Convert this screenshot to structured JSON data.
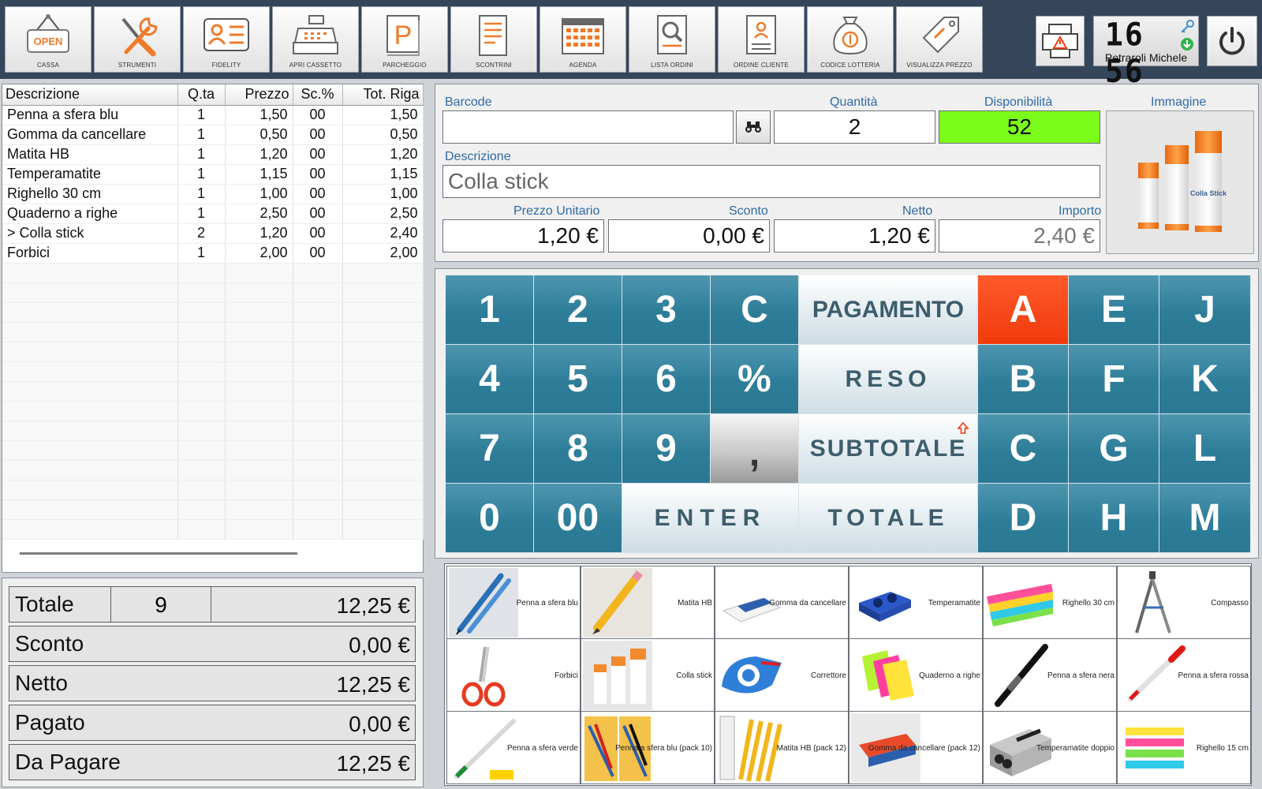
{
  "toolbar": {
    "buttons": [
      {
        "label": "CASSA",
        "icon": "open-sign-icon"
      },
      {
        "label": "STRUMENTI",
        "icon": "tools-icon"
      },
      {
        "label": "FIDELITY",
        "icon": "id-card-icon"
      },
      {
        "label": "APRI CASSETTO",
        "icon": "cash-register-icon"
      },
      {
        "label": "PARCHEGGIO",
        "icon": "parking-icon"
      },
      {
        "label": "SCONTRINI",
        "icon": "receipt-icon"
      },
      {
        "label": "AGENDA",
        "icon": "calendar-icon"
      },
      {
        "label": "LISTA ORDINI",
        "icon": "order-search-icon"
      },
      {
        "label": "ORDINE CLIENTE",
        "icon": "customer-order-icon"
      },
      {
        "label": "CODICE LOTTERIA",
        "icon": "money-bag-icon"
      },
      {
        "label": "VISUALIZZA PREZZO",
        "icon": "price-tag-icon"
      }
    ],
    "open_sign_text": "OPEN",
    "parking_letter": "P",
    "clock": {
      "time": "16 56",
      "user": "Petraroli Michele"
    },
    "accent_color": "#f07a2a"
  },
  "receipt": {
    "columns": [
      "Descrizione",
      "Q.ta",
      "Prezzo",
      "Sc.%",
      "Tot. Riga"
    ],
    "rows": [
      [
        "Penna a sfera blu",
        "1",
        "1,50",
        "00",
        "1,50"
      ],
      [
        "Gomma da cancellare",
        "1",
        "0,50",
        "00",
        "0,50"
      ],
      [
        "Matita HB",
        "1",
        "1,20",
        "00",
        "1,20"
      ],
      [
        "Temperamatite",
        "1",
        "1,15",
        "00",
        "1,15"
      ],
      [
        "Righello 30 cm",
        "1",
        "1,00",
        "00",
        "1,00"
      ],
      [
        "Quaderno a righe",
        "1",
        "2,50",
        "00",
        "2,50"
      ],
      [
        "> Colla stick",
        "2",
        "1,20",
        "00",
        "2,40"
      ],
      [
        "Forbici",
        "1",
        "2,00",
        "00",
        "2,00"
      ]
    ]
  },
  "totals": {
    "totale": {
      "label": "Totale",
      "qty": "9",
      "value": "12,25 €"
    },
    "sconto": {
      "label": "Sconto",
      "value": "0,00 €"
    },
    "netto": {
      "label": "Netto",
      "value": "12,25 €"
    },
    "pagato": {
      "label": "Pagato",
      "value": "0,00 €"
    },
    "da_pagare": {
      "label": "Da Pagare",
      "value": "12,25 €"
    }
  },
  "item": {
    "barcode_label": "Barcode",
    "barcode_value": "",
    "quantity_label": "Quantità",
    "quantity_value": "2",
    "availability_label": "Disponibilità",
    "availability_value": "52",
    "availability_color": "#7cfc1a",
    "image_label": "Immagine",
    "description_label": "Descrizione",
    "description_value": "Colla stick",
    "unit_price_label": "Prezzo Unitario",
    "unit_price_value": "1,20 €",
    "discount_label": "Sconto",
    "discount_value": "0,00 €",
    "net_label": "Netto",
    "net_value": "1,20 €",
    "amount_label": "Importo",
    "amount_value": "2,40 €",
    "glue_label": "Colla Stick"
  },
  "keypad": {
    "digits": [
      "1",
      "2",
      "3",
      "C",
      "4",
      "5",
      "6",
      "%",
      "7",
      "8",
      "9",
      ",",
      "0",
      "00"
    ],
    "enter": "ENTER",
    "pagamento": "PAGAMENTO",
    "reso": "RESO",
    "subtotale": "SUBTOTALE",
    "totale": "TOTALE",
    "letters": [
      "A",
      "E",
      "J",
      "B",
      "F",
      "K",
      "C",
      "G",
      "L",
      "D",
      "H",
      "M"
    ],
    "colors": {
      "teal": "#2d7d98",
      "active": "#f03a0b"
    }
  },
  "products": [
    "Penna a sfera blu",
    "Matita HB",
    "Gomma da cancellare",
    "Temperamatite",
    "Righello 30 cm",
    "Compasso",
    "Forbici",
    "Colla stick",
    "Correttore",
    "Quaderno a righe",
    "Penna a sfera nera",
    "Penna a sfera rossa",
    "Penna a sfera verde",
    "Penna a sfera blu (pack 10)",
    "Matita HB (pack 12)",
    "Gomma da cancellare (pack 12)",
    "Temperamatite doppio",
    "Righello 15 cm"
  ]
}
